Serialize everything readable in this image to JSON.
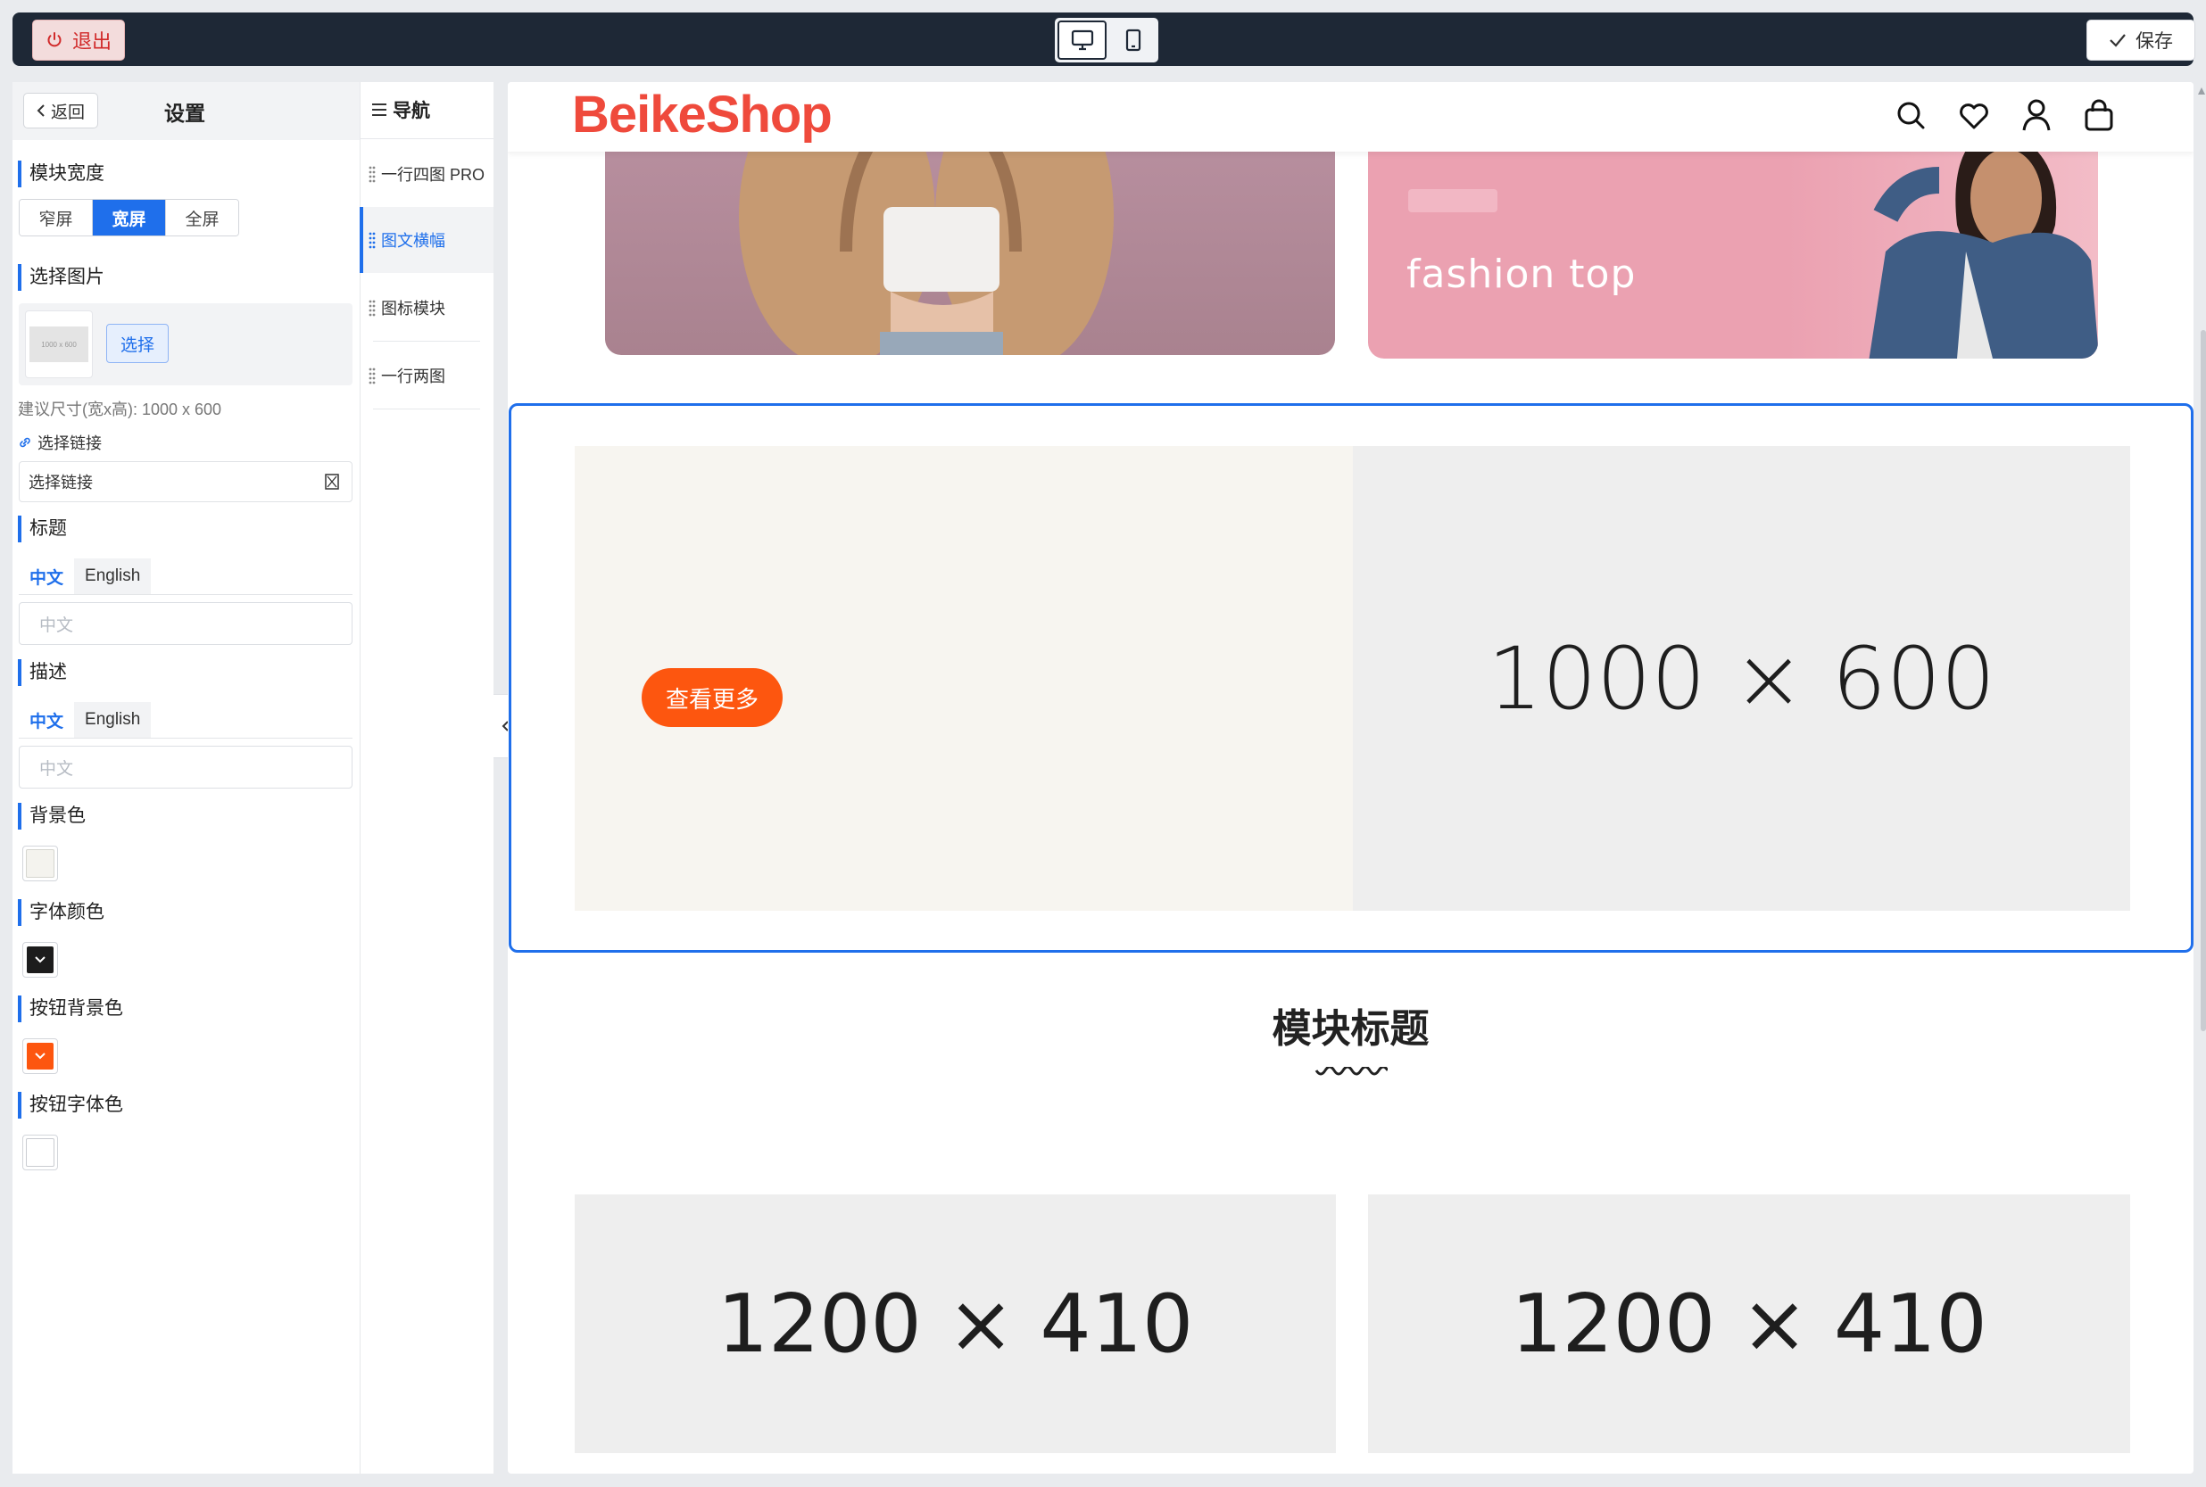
{
  "topbar": {
    "exit_label": "退出",
    "save_label": "保存",
    "devices": [
      {
        "name": "desktop",
        "icon": "monitor-icon",
        "active": true
      },
      {
        "name": "mobile",
        "icon": "phone-icon",
        "active": false
      }
    ]
  },
  "settings": {
    "back_label": "返回",
    "title": "设置",
    "width": {
      "label": "模块宽度",
      "options": [
        "窄屏",
        "宽屏",
        "全屏"
      ],
      "selected": "宽屏"
    },
    "image": {
      "label": "选择图片",
      "thumb_text": "1000 x 600",
      "choose_label": "选择",
      "hint": "建议尺寸(宽x高): 1000 x 600"
    },
    "link": {
      "label": "选择链接",
      "field_value": "选择链接"
    },
    "title_field": {
      "label": "标题",
      "tabs": [
        "中文",
        "English"
      ],
      "placeholder": "中文"
    },
    "desc_field": {
      "label": "描述",
      "tabs": [
        "中文",
        "English"
      ],
      "placeholder": "中文"
    },
    "colors": [
      {
        "label": "背景色",
        "value": "#f7f5f0"
      },
      {
        "label": "字体颜色",
        "value": "#1c1c1c"
      },
      {
        "label": "按钮背景色",
        "value": "#fd560f"
      },
      {
        "label": "按钮字体色",
        "value": "#ffffff"
      }
    ]
  },
  "nav": {
    "title": "导航",
    "items": [
      {
        "label": "一行四图 PRO",
        "active": false
      },
      {
        "label": "图文横幅",
        "active": true
      },
      {
        "label": "图标模块",
        "active": false
      },
      {
        "label": "一行两图",
        "active": false
      }
    ]
  },
  "preview": {
    "logo": "BeikeShop",
    "header_icons": [
      "search-icon",
      "heart-icon",
      "user-icon",
      "bag-icon"
    ],
    "banner_right_caption": "fashion top",
    "image_text_block": {
      "button_label": "查看更多",
      "image_placeholder": "1000 × 600",
      "bg_color": "#f7f5f0",
      "button_color": "#fd560f"
    },
    "module_title": "模块标题",
    "bottom_images": [
      "1200 × 410",
      "1200 × 410"
    ]
  },
  "colors": {
    "accent": "#1f6feb",
    "brand": "#ef4a3c",
    "topbar": "#1e2836"
  }
}
